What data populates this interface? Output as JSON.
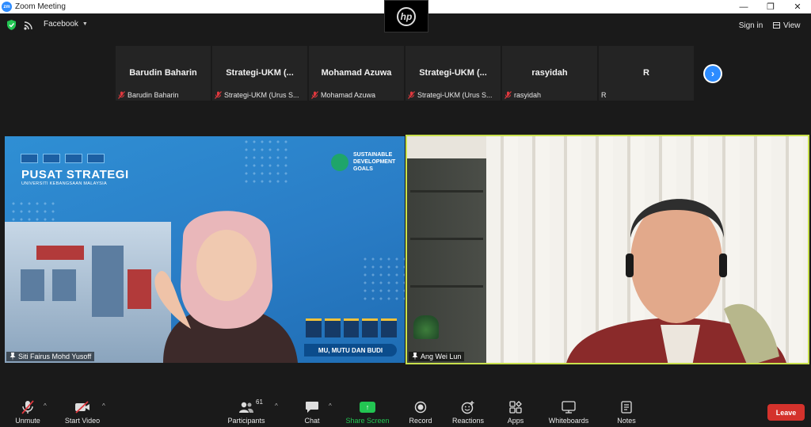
{
  "window": {
    "app_logo": "zm",
    "title": "Zoom Meeting",
    "controls": {
      "minimize": "—",
      "maximize": "❐",
      "close": "✕"
    },
    "camera_logo": "hp"
  },
  "top_bar": {
    "stream_target": "Facebook",
    "sign_in_label": "Sign in",
    "view_label": "View"
  },
  "participants_strip": [
    {
      "name": "Barudin Baharin",
      "label": "Barudin Baharin",
      "muted": true
    },
    {
      "name": "Strategi-UKM  (...",
      "label": "Strategi-UKM (Urus S...",
      "muted": true
    },
    {
      "name": "Mohamad Azuwa",
      "label": "Mohamad Azuwa",
      "muted": true
    },
    {
      "name": "Strategi-UKM  (...",
      "label": "Strategi-UKM (Urus S...",
      "muted": true
    },
    {
      "name": "rasyidah",
      "label": "rasyidah",
      "muted": true
    },
    {
      "name": "R",
      "label": "R",
      "muted": false
    }
  ],
  "videos": {
    "left": {
      "name": "Siti Fairus Mohd Yusoff",
      "brand_title": "PUSAT STRATEGI",
      "brand_subtitle": "UNIVERSITI KEBANGSAAN MALAYSIA",
      "sdg_text": [
        "SUSTAINABLE",
        "DEVELOPMENT",
        "GOALS"
      ],
      "banner_text": "MU, MUTU DAN BUDI"
    },
    "right": {
      "name": "Ang Wei Lun",
      "active_speaker_color": "#c8e04c"
    }
  },
  "toolbar": {
    "unmute": "Unmute",
    "start_video": "Start Video",
    "participants": "Participants",
    "participant_count": "61",
    "chat": "Chat",
    "share_screen": "Share Screen",
    "record": "Record",
    "reactions": "Reactions",
    "apps": "Apps",
    "whiteboards": "Whiteboards",
    "notes": "Notes",
    "leave": "Leave"
  },
  "colors": {
    "accent_blue": "#2d8cff",
    "share_green": "#23c552",
    "leave_red": "#d4322c",
    "mute_red": "#e0383e"
  }
}
